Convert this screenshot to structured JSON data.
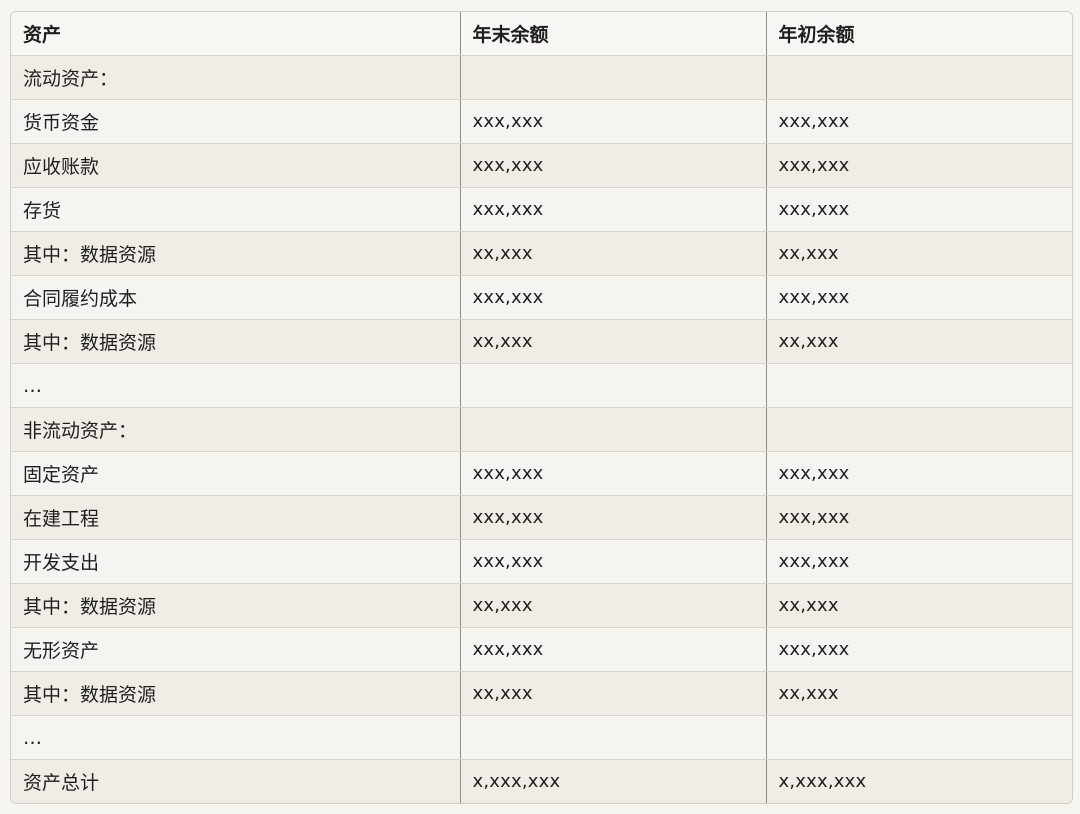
{
  "table": {
    "headers": [
      "资产",
      "年末余额",
      "年初余额"
    ],
    "rows": [
      [
        "流动资产：",
        "",
        ""
      ],
      [
        "货币资金",
        "xxx,xxx",
        "xxx,xxx"
      ],
      [
        "应收账款",
        "xxx,xxx",
        "xxx,xxx"
      ],
      [
        "存货",
        "xxx,xxx",
        "xxx,xxx"
      ],
      [
        "其中：数据资源",
        "xx,xxx",
        "xx,xxx"
      ],
      [
        "合同履约成本",
        "xxx,xxx",
        "xxx,xxx"
      ],
      [
        "其中：数据资源",
        "xx,xxx",
        "xx,xxx"
      ],
      [
        "…",
        "",
        ""
      ],
      [
        "非流动资产：",
        "",
        ""
      ],
      [
        "固定资产",
        "xxx,xxx",
        "xxx,xxx"
      ],
      [
        "在建工程",
        "xxx,xxx",
        "xxx,xxx"
      ],
      [
        "开发支出",
        "xxx,xxx",
        "xxx,xxx"
      ],
      [
        "其中：数据资源",
        "xx,xxx",
        "xx,xxx"
      ],
      [
        "无形资产",
        "xxx,xxx",
        "xxx,xxx"
      ],
      [
        "其中：数据资源",
        "xx,xxx",
        "xx,xxx"
      ],
      [
        "…",
        "",
        ""
      ],
      [
        "资产总计",
        "x,xxx,xxx",
        "x,xxx,xxx"
      ]
    ]
  }
}
